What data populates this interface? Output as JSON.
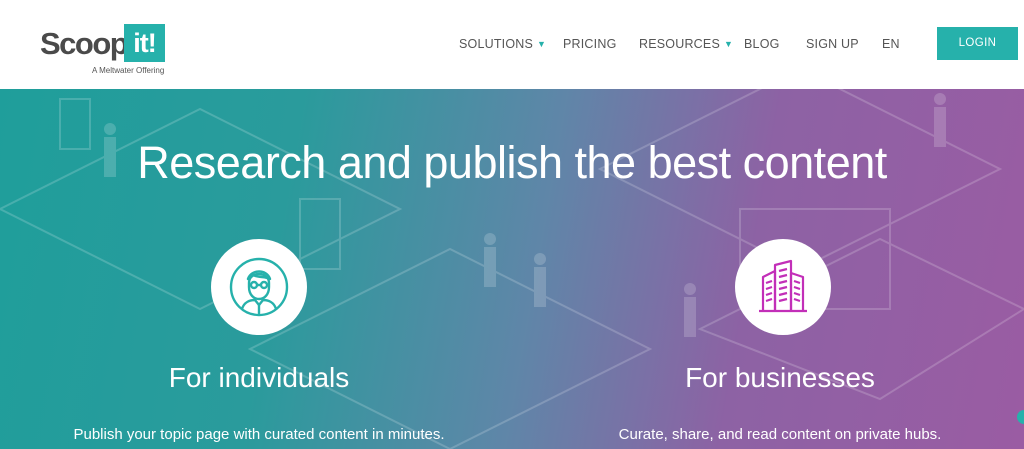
{
  "logo": {
    "word": "Scoop.",
    "box": "it!",
    "sub": "A Meltwater Offering"
  },
  "nav": {
    "items": [
      {
        "label": "SOLUTIONS",
        "caret": "▼"
      },
      {
        "label": "PRICING"
      },
      {
        "label": "RESOURCES",
        "caret": "▼"
      },
      {
        "label": "BLOG"
      },
      {
        "label": "SIGN UP"
      },
      {
        "label": "EN"
      }
    ],
    "login": "LOGIN"
  },
  "hero": {
    "title": "Research and publish the best content",
    "individuals": {
      "heading": "For individuals",
      "description": "Publish your topic page with curated content in minutes.",
      "icon": "person-icon"
    },
    "businesses": {
      "heading": "For businesses",
      "description": "Curate, share, and read content on private hubs.",
      "icon": "buildings-icon"
    }
  },
  "colors": {
    "brand": "#26b1ab",
    "teal": "#1f9e9b",
    "purple": "#9a5ca3",
    "business_icon": "#c22fb8"
  }
}
